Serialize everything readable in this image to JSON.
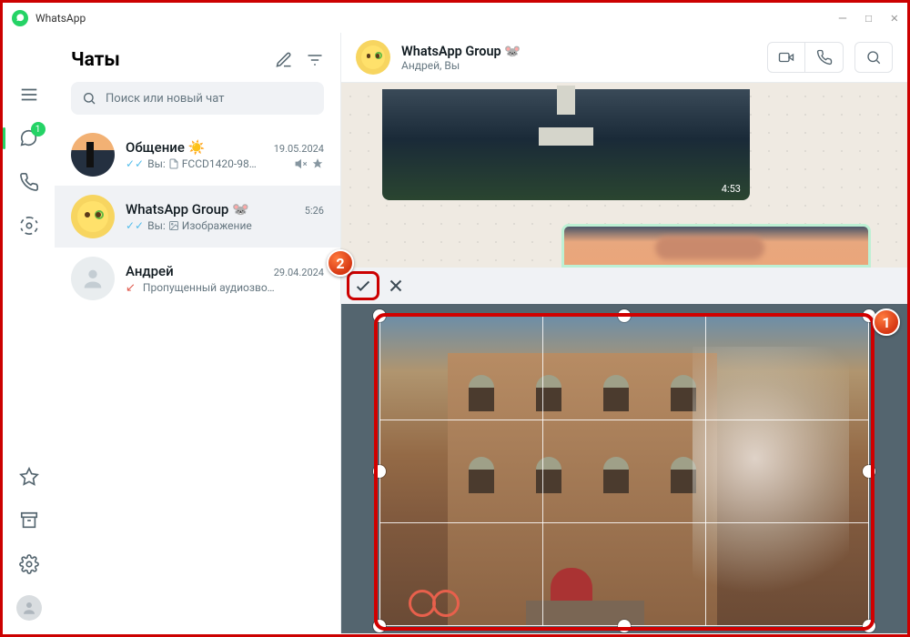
{
  "app": {
    "title": "WhatsApp"
  },
  "window_controls": {
    "minimize": "—",
    "maximize": "☐",
    "close": "✕"
  },
  "nav": {
    "unread_badge": "1"
  },
  "list": {
    "header": "Чаты",
    "search_placeholder": "Поиск или новый чат"
  },
  "chats": [
    {
      "name": "Общение ☀️",
      "date": "19.05.2024",
      "checks": "✓✓",
      "prefix": "Вы:",
      "preview": "FCCD1420-98…",
      "muted": true,
      "pinned": true,
      "has_doc": true
    },
    {
      "name": "WhatsApp Group 🐭",
      "date": "5:26",
      "checks": "✓✓",
      "prefix": "Вы:",
      "preview": "Изображение",
      "selected": true,
      "has_image": true
    },
    {
      "name": "Андрей",
      "date": "29.04.2024",
      "preview": "Пропущенный аудиозво…",
      "missed": true
    }
  ],
  "conversation": {
    "title": "WhatsApp Group 🐭",
    "subtitle": "Андрей, Вы",
    "video_timestamp": "4:53"
  },
  "callouts": {
    "one": "1",
    "two": "2"
  }
}
